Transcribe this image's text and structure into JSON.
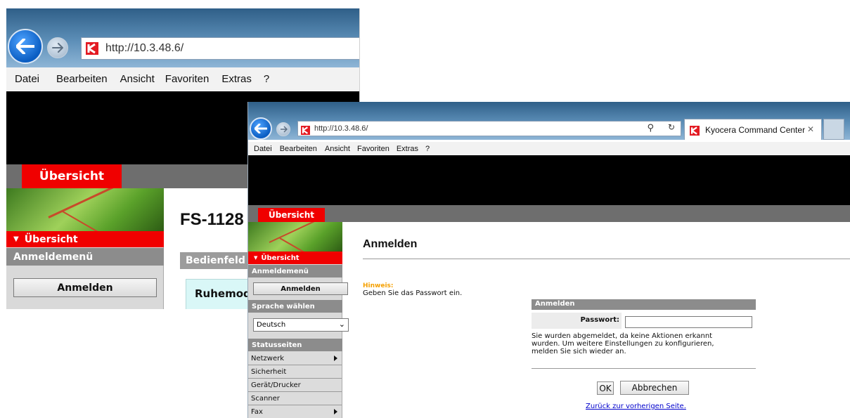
{
  "back_window": {
    "address": "http://10.3.48.6/",
    "menu": [
      "Datei",
      "Bearbeiten",
      "Ansicht",
      "Favoriten",
      "Extras",
      "?"
    ],
    "top_tab": "Übersicht",
    "sidebar": {
      "overview": "Übersicht",
      "login_menu": "Anmeldemenü",
      "login_button": "Anmelden"
    },
    "main": {
      "title": "FS-1128",
      "section": "Bedienfeld",
      "mode": "Ruhemod"
    }
  },
  "front_window": {
    "address": "http://10.3.48.6/",
    "tab_title": "Kyocera Command Center",
    "menu": [
      "Datei",
      "Bearbeiten",
      "Ansicht",
      "Favoriten",
      "Extras",
      "?"
    ],
    "top_tab": "Übersicht",
    "sidebar": {
      "overview": "Übersicht",
      "login_menu": "Anmeldemenü",
      "login_button": "Anmelden",
      "language_head": "Sprache wählen",
      "language_selected": "Deutsch",
      "status_head": "Statusseiten",
      "status_items": [
        {
          "label": "Netzwerk",
          "submenu": true
        },
        {
          "label": "Sicherheit",
          "submenu": false
        },
        {
          "label": "Gerät/Drucker",
          "submenu": false
        },
        {
          "label": "Scanner",
          "submenu": false
        },
        {
          "label": "Fax",
          "submenu": true
        }
      ]
    },
    "main": {
      "heading": "Anmelden",
      "hint_label": "Hinweis:",
      "hint_text": "Geben Sie das Passwort ein.",
      "panel_title": "Anmelden",
      "password_label": "Passwort:",
      "password_value": "",
      "message_line1": "Sie wurden abgemeldet, da keine Aktionen erkannt",
      "message_line2": "wurden. Um weitere Einstellungen zu konfigurieren,",
      "message_line3": "melden Sie sich wieder an.",
      "ok_button": "OK",
      "cancel_button": "Abbrechen",
      "back_link": "Zurück zur vorherigen Seite."
    }
  },
  "colors": {
    "brand_red": "#f00000",
    "hint_orange": "#f5a000",
    "link_blue": "#0000cc"
  }
}
